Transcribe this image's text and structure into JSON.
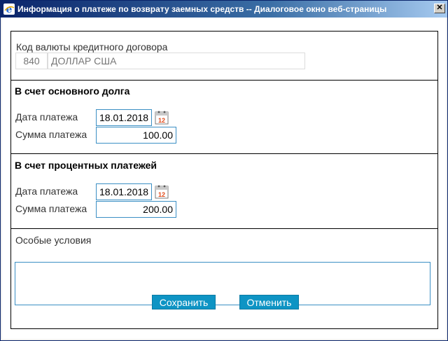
{
  "window": {
    "title": "Информация о платеже по возврату заемных средств -- Диалоговое окно веб-страницы",
    "close_label": "✕"
  },
  "currency": {
    "label": "Код валюты кредитного договора",
    "code": "840",
    "name": "ДОЛЛАР США"
  },
  "principal": {
    "header": "В счет основного долга",
    "date_label": "Дата платежа",
    "date_value": "18.01.2018",
    "amount_label": "Сумма платежа",
    "amount_value": "100.00"
  },
  "interest": {
    "header": "В счет процентных платежей",
    "date_label": "Дата платежа",
    "date_value": "18.01.2018",
    "amount_label": "Сумма платежа",
    "amount_value": "200.00"
  },
  "conditions": {
    "label": "Особые условия",
    "value": ""
  },
  "calendar": {
    "day_text": "12"
  },
  "buttons": {
    "save_label": "Сохранить",
    "cancel_label": "Отменить"
  },
  "colors": {
    "accent": "#0e94c4",
    "input_border": "#3b8fc4",
    "title_bar": "#0a246a"
  }
}
